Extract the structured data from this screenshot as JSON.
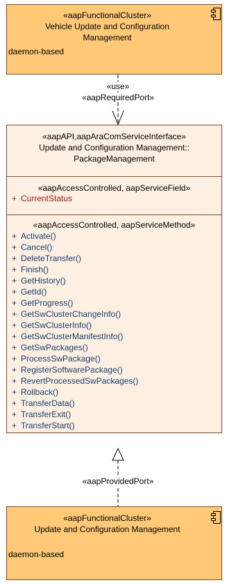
{
  "top_cluster": {
    "stereotype": "«aapFunctionalCluster»",
    "name_line1": "Vehicle Update and Configuration",
    "name_line2": "Management",
    "note": "daemon-based",
    "icon": "component-icon"
  },
  "use_connector": {
    "label1": "«use»",
    "label2": "«aapRequiredPort»"
  },
  "interface": {
    "stereotype": "«aapAPI,aapAraComServiceInterface»",
    "name_line1": "Update and Configuration Management::",
    "name_line2": "PackageManagement",
    "field_section_stereotype": "«aapAccessControlled, aapServiceField»",
    "fields": [
      {
        "vis": "+",
        "name": "CurrentStatus"
      }
    ],
    "method_section_stereotype": "«aapAccessControlled, aapServiceMethod»",
    "methods": [
      {
        "vis": "+",
        "name": "Activate()"
      },
      {
        "vis": "+",
        "name": "Cancel()"
      },
      {
        "vis": "+",
        "name": "DeleteTransfer()"
      },
      {
        "vis": "+",
        "name": "Finish()"
      },
      {
        "vis": "+",
        "name": "GetHistory()"
      },
      {
        "vis": "+",
        "name": "GetId()"
      },
      {
        "vis": "+",
        "name": "GetProgress()"
      },
      {
        "vis": "+",
        "name": "GetSwClusterChangeInfo()"
      },
      {
        "vis": "+",
        "name": "GetSwClusterInfo()"
      },
      {
        "vis": "+",
        "name": "GetSwClusterManifestInfo()"
      },
      {
        "vis": "+",
        "name": "GetSwPackages()"
      },
      {
        "vis": "+",
        "name": "ProcessSwPackage()"
      },
      {
        "vis": "+",
        "name": "RegisterSoftwarePackage()"
      },
      {
        "vis": "+",
        "name": "RevertProcessedSwPackages()"
      },
      {
        "vis": "+",
        "name": "Rollback()"
      },
      {
        "vis": "+",
        "name": "TransferData()"
      },
      {
        "vis": "+",
        "name": "TransferExit()"
      },
      {
        "vis": "+",
        "name": "TransferStart()"
      }
    ]
  },
  "provided_connector": {
    "label": "«aapProvidedPort»"
  },
  "bottom_cluster": {
    "stereotype": "«aapFunctionalCluster»",
    "name": "Update and Configuration Management",
    "note": "daemon-based",
    "icon": "component-icon"
  },
  "colors": {
    "cluster_fill": "#ffc978",
    "interface_fill": "#fdf0e2",
    "border": "#7a4a2e",
    "attribute_text": "#8b1a1a",
    "method_text": "#1a3b6e"
  }
}
